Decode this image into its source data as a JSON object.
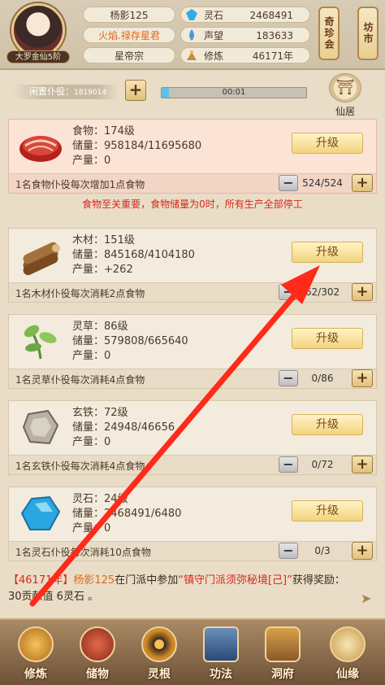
{
  "player": {
    "name": "杨影125",
    "title": "火焰.禄存星君",
    "sect": "星帝宗",
    "rank": "大罗金仙5阶"
  },
  "resources": [
    {
      "label": "灵石",
      "value": "2468491",
      "icon": "spirit-stone-icon",
      "color": "#36a9e8"
    },
    {
      "label": "声望",
      "value": "183633",
      "icon": "prestige-icon",
      "color": "#4b9ad1"
    },
    {
      "label": "修炼",
      "value": "46171年",
      "icon": "cultivation-icon",
      "color": "#c88a3a"
    }
  ],
  "side_buttons": {
    "treasure": "奇珍会",
    "market": "坊市"
  },
  "servants": {
    "idle_label": "闲置仆役",
    "idle_count": "1819014",
    "timer": "00:01",
    "progress": 0.05,
    "home_label": "仙居"
  },
  "upgrade_label": "升级",
  "field_labels": {
    "storage": "储量：",
    "output": "产量："
  },
  "warning": "食物至关重要，食物储量为0时，所有生产全部停工",
  "cards": [
    {
      "name": "食物",
      "level": "174级",
      "storage": "958184/11695680",
      "output": "0",
      "footer": "1名食物仆役每次增加1点食物",
      "count": "524/524",
      "icon": "meat-icon"
    },
    {
      "name": "木材",
      "level": "151级",
      "storage": "845168/4104180",
      "output": "+262",
      "footer": "1名木材仆役每次消耗2点食物",
      "count": "62/302",
      "icon": "wood-icon"
    },
    {
      "name": "灵草",
      "level": "86级",
      "storage": "579808/665640",
      "output": "0",
      "footer": "1名灵草仆役每次消耗4点食物",
      "count": "0/86",
      "icon": "herb-icon"
    },
    {
      "name": "玄铁",
      "level": "72级",
      "storage": "24948/46656",
      "output": "0",
      "footer": "1名玄铁仆役每次消耗4点食物",
      "count": "0/72",
      "icon": "iron-icon"
    },
    {
      "name": "灵石",
      "level": "24级",
      "storage": "2468491/6480",
      "output": "0",
      "footer": "1名灵石仆役每次消耗10点食物",
      "count": "0/3",
      "icon": "crystal-icon"
    }
  ],
  "log": {
    "year": "【46171年】",
    "player": "杨影125",
    "text1": "在门派中参加",
    "event": "“镇守门派须弥秘境[己]”",
    "text2": "获得奖励：30贡献值 6灵石 。"
  },
  "nav": [
    {
      "label": "修炼",
      "icon": "cultivation-icon"
    },
    {
      "label": "储物",
      "icon": "storage-bag-icon"
    },
    {
      "label": "灵根",
      "icon": "spirit-root-icon"
    },
    {
      "label": "功法",
      "icon": "technique-book-icon"
    },
    {
      "label": "洞府",
      "icon": "cave-mansion-icon"
    },
    {
      "label": "仙缘",
      "icon": "immortal-fate-icon"
    }
  ]
}
